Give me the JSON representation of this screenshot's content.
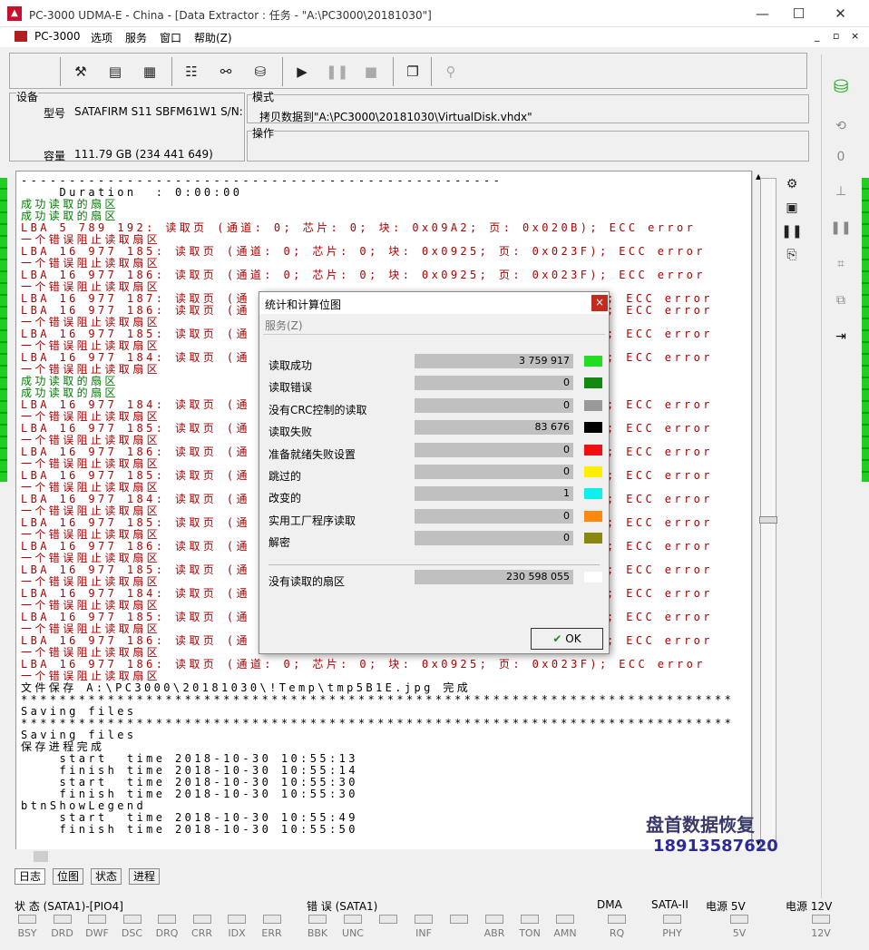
{
  "window": {
    "title": "PC-3000 UDMA-E - China - [Data Extractor : 任务 - \"A:\\PC3000\\20181030\"]",
    "min": "—",
    "max": "☐",
    "close": "✕"
  },
  "menu": {
    "items": [
      "PC-3000",
      "选项",
      "服务",
      "窗口",
      "帮助(Z)"
    ],
    "mdi": [
      "_",
      "▫",
      "×"
    ]
  },
  "device": {
    "label": "设备",
    "model_label": "型号",
    "model": "SATAFIRM   S11 SBFM61W1 S/N:1BD",
    "capacity_label": "容量",
    "capacity": "111.79 GB (234 441 649)"
  },
  "mode": {
    "label": "模式",
    "value": "拷贝数据到\"A:\\PC3000\\20181030\\VirtualDisk.vhdx\"",
    "op_label": "操作"
  },
  "log": [
    {
      "c": "blk",
      "t": "--------------------------------------------------"
    },
    {
      "c": "blk",
      "t": "    Duration  : 0:00:00"
    },
    {
      "c": "green",
      "t": "成功读取的扇区"
    },
    {
      "c": "green",
      "t": "成功读取的扇区"
    },
    {
      "c": "red",
      "t": "LBA 5 789 192: 读取页 (通道: 0; 芯片: 0; 块: 0x09A2; 页: 0x020B); ECC error"
    },
    {
      "c": "red",
      "t": "一个错误阻止读取扇区"
    },
    {
      "c": "red",
      "t": "LBA 16 977 185: 读取页 (通道: 0; 芯片: 0; 块: 0x0925; 页: 0x023F); ECC error"
    },
    {
      "c": "red",
      "t": "一个错误阻止读取扇区"
    },
    {
      "c": "red",
      "t": "LBA 16 977 186: 读取页 (通道: 0; 芯片: 0; 块: 0x0925; 页: 0x023F); ECC error"
    },
    {
      "c": "red",
      "t": "一个错误阻止读取扇区"
    },
    {
      "c": "red",
      "t": "LBA 16 977 187: 读取页 (通                                   F); ECC error"
    },
    {
      "c": "red",
      "t": "LBA 16 977 186: 读取页 (通                                   F); ECC error"
    },
    {
      "c": "red",
      "t": "一个错误阻止读取扇区"
    },
    {
      "c": "red",
      "t": "LBA 16 977 185: 读取页 (通                                   F); ECC error"
    },
    {
      "c": "red",
      "t": "一个错误阻止读取扇区"
    },
    {
      "c": "red",
      "t": "LBA 16 977 184: 读取页 (通                                   F); ECC error"
    },
    {
      "c": "red",
      "t": "一个错误阻止读取扇区"
    },
    {
      "c": "green",
      "t": "成功读取的扇区"
    },
    {
      "c": "green",
      "t": "成功读取的扇区"
    },
    {
      "c": "red",
      "t": "LBA 16 977 184: 读取页 (通                                   F); ECC error"
    },
    {
      "c": "red",
      "t": "一个错误阻止读取扇区"
    },
    {
      "c": "red",
      "t": "LBA 16 977 185: 读取页 (通                                   F); ECC error"
    },
    {
      "c": "red",
      "t": "一个错误阻止读取扇区"
    },
    {
      "c": "red",
      "t": "LBA 16 977 186: 读取页 (通                                   F); ECC error"
    },
    {
      "c": "red",
      "t": "一个错误阻止读取扇区"
    },
    {
      "c": "red",
      "t": "LBA 16 977 185: 读取页 (通                                   F); ECC error"
    },
    {
      "c": "red",
      "t": "一个错误阻止读取扇区"
    },
    {
      "c": "red",
      "t": "LBA 16 977 184: 读取页 (通                                   F); ECC error"
    },
    {
      "c": "red",
      "t": "一个错误阻止读取扇区"
    },
    {
      "c": "red",
      "t": "LBA 16 977 185: 读取页 (通                                   F); ECC error"
    },
    {
      "c": "red",
      "t": "一个错误阻止读取扇区"
    },
    {
      "c": "red",
      "t": "LBA 16 977 186: 读取页 (通                                   F); ECC error"
    },
    {
      "c": "red",
      "t": "一个错误阻止读取扇区"
    },
    {
      "c": "red",
      "t": "LBA 16 977 185: 读取页 (通                                   F); ECC error"
    },
    {
      "c": "red",
      "t": "一个错误阻止读取扇区"
    },
    {
      "c": "red",
      "t": "LBA 16 977 184: 读取页 (通                                   F); ECC error"
    },
    {
      "c": "red",
      "t": "一个错误阻止读取扇区"
    },
    {
      "c": "red",
      "t": "LBA 16 977 185: 读取页 (通                                   F); ECC error"
    },
    {
      "c": "red",
      "t": "一个错误阻止读取扇区"
    },
    {
      "c": "red",
      "t": "LBA 16 977 186: 读取页 (通                                   F); ECC error"
    },
    {
      "c": "red",
      "t": "一个错误阻止读取扇区"
    },
    {
      "c": "red",
      "t": "LBA 16 977 186: 读取页 (通道: 0; 芯片: 0; 块: 0x0925; 页: 0x023F); ECC error"
    },
    {
      "c": "red",
      "t": "一个错误阻止读取扇区"
    },
    {
      "c": "blk",
      "t": "文件保存 A:\\PC3000\\20181030\\!Temp\\tmp5B1E.jpg 完成"
    },
    {
      "c": "blk",
      "t": "**************************************************************************"
    },
    {
      "c": "blk",
      "t": "Saving files"
    },
    {
      "c": "blk",
      "t": "**************************************************************************"
    },
    {
      "c": "blk",
      "t": "Saving files"
    },
    {
      "c": "blk",
      "t": "保存进程完成"
    },
    {
      "c": "blk",
      "t": "    start  time 2018-10-30 10:55:13"
    },
    {
      "c": "blk",
      "t": "    finish time 2018-10-30 10:55:14"
    },
    {
      "c": "blk",
      "t": "    start  time 2018-10-30 10:55:30"
    },
    {
      "c": "blk",
      "t": "    finish time 2018-10-30 10:55:30"
    },
    {
      "c": "blk",
      "t": "btnShowLegend"
    },
    {
      "c": "blk",
      "t": "    start  time 2018-10-30 10:55:49"
    },
    {
      "c": "blk",
      "t": "    finish time 2018-10-30 10:55:50"
    }
  ],
  "tabs": [
    "日志",
    "位图",
    "状态",
    "进程"
  ],
  "dialog": {
    "title": "统计和计算位图",
    "close": "×",
    "menu": "服务(Z)",
    "rows": [
      {
        "label": "读取成功",
        "value": "3 759 917",
        "color": "#22dd22"
      },
      {
        "label": "读取错误",
        "value": "0",
        "color": "#118811"
      },
      {
        "label": "没有CRC控制的读取",
        "value": "0",
        "color": "#999999"
      },
      {
        "label": "读取失败",
        "value": "83 676",
        "color": "#000000"
      },
      {
        "label": "准备就绪失败设置",
        "value": "0",
        "color": "#ee1111"
      },
      {
        "label": "跳过的",
        "value": "0",
        "color": "#ffee00"
      },
      {
        "label": "改变的",
        "value": "1",
        "color": "#11eeee"
      },
      {
        "label": "实用工厂程序读取",
        "value": "0",
        "color": "#ff8811"
      },
      {
        "label": "解密",
        "value": "0",
        "color": "#888811"
      }
    ],
    "unread": {
      "label": "没有读取的扇区",
      "value": "230 598 055",
      "color": "#ffffff"
    },
    "ok": "OK",
    "ok_check": "✔"
  },
  "status": {
    "state_label": "状 态 (SATA1)-[PIO4]",
    "state_leds": [
      "BSY",
      "DRD",
      "DWF",
      "DSC",
      "DRQ",
      "CRR",
      "IDX",
      "ERR"
    ],
    "error_label": "错 误 (SATA1)",
    "error_leds": [
      "BBK",
      "UNC",
      "",
      "INF",
      "",
      "ABR",
      "TON",
      "AMN"
    ],
    "dma_label": "DMA",
    "dma_led": "RQ",
    "sata_label": "SATA-II",
    "sata_led": "PHY",
    "p5_label": "电源 5V",
    "p5_led": "5V",
    "p12_label": "电源 12V",
    "p12_led": "12V"
  },
  "watermark": {
    "line1": "盘首数据恢复",
    "line2": "18913587620"
  }
}
